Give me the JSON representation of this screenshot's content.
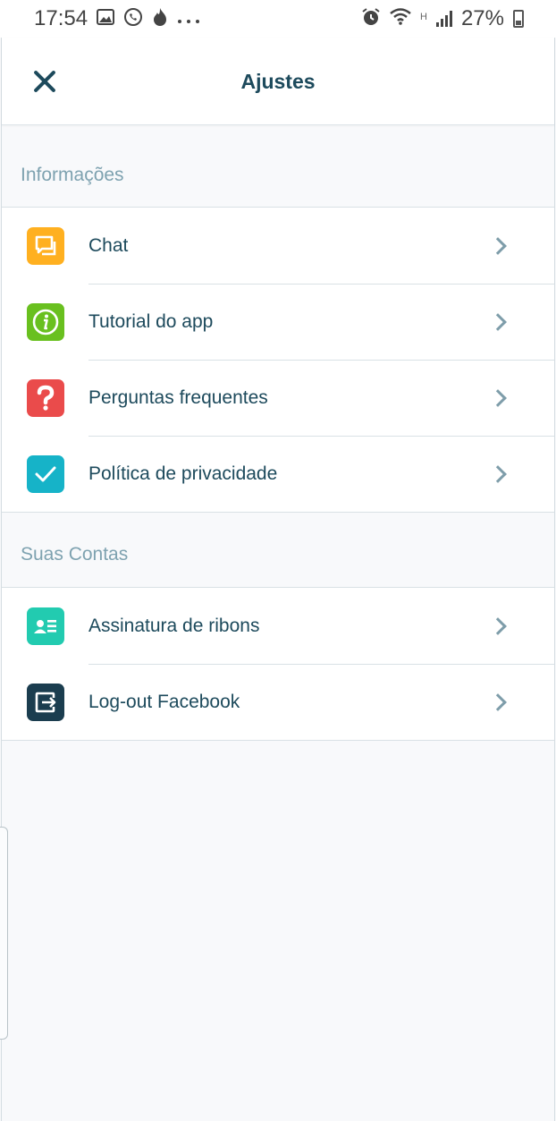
{
  "status_bar": {
    "time": "17:54",
    "network_h": "H",
    "battery": "27%"
  },
  "header": {
    "title": "Ajustes",
    "close_icon": "close-icon"
  },
  "sections": [
    {
      "title": "Informações",
      "items": [
        {
          "label": "Chat",
          "icon": "chat-icon",
          "color": "#ffb020"
        },
        {
          "label": "Tutorial do app",
          "icon": "info-icon",
          "color": "#69c01f"
        },
        {
          "label": "Perguntas frequentes",
          "icon": "question-icon",
          "color": "#ea4b4b"
        },
        {
          "label": "Política de privacidade",
          "icon": "check-icon",
          "color": "#16b3c8"
        }
      ]
    },
    {
      "title": "Suas Contas",
      "items": [
        {
          "label": "Assinatura de ribons",
          "icon": "contact-card-icon",
          "color": "#22cbb0"
        },
        {
          "label": "Log-out Facebook",
          "icon": "logout-icon",
          "color": "#1b3d4f"
        }
      ]
    }
  ]
}
